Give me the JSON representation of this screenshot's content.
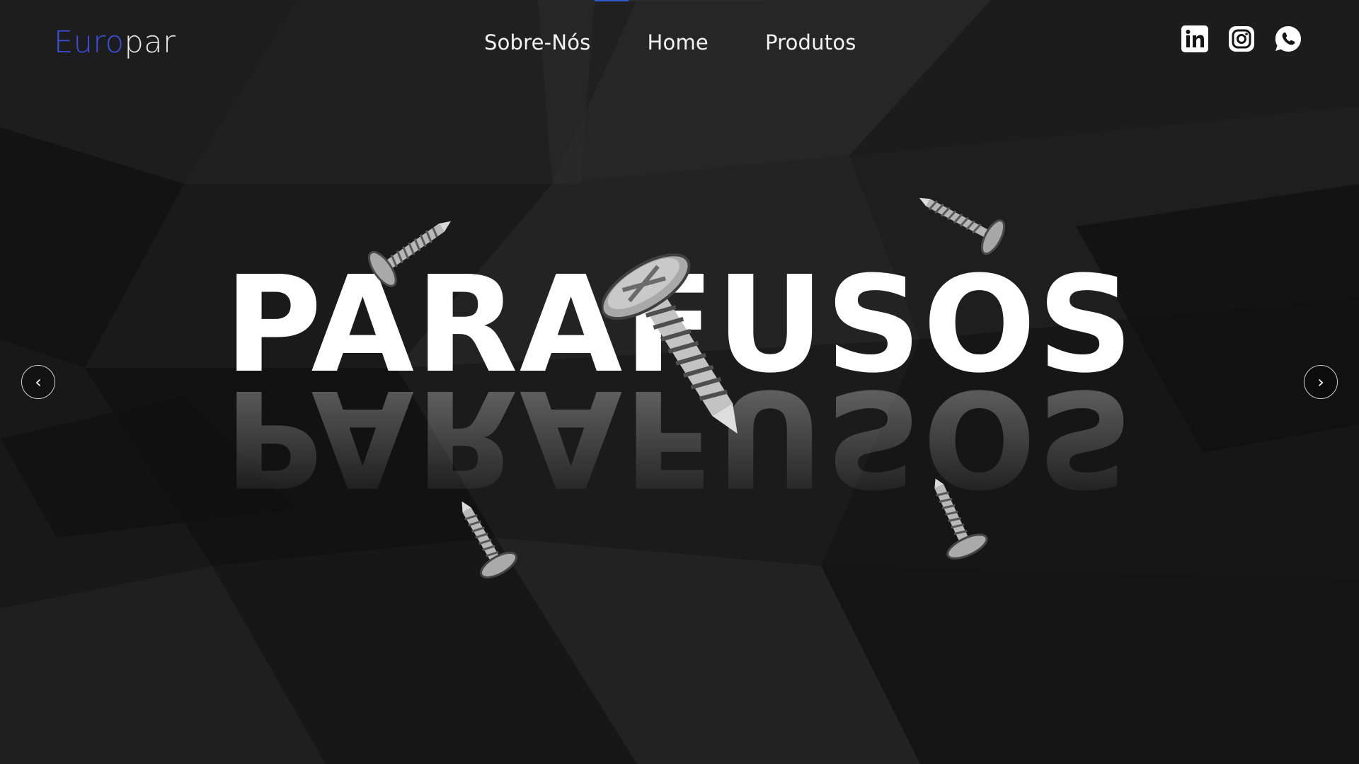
{
  "brand": {
    "logo_part1": "Euro",
    "logo_part2": "par"
  },
  "nav": {
    "items": [
      "Sobre-Nós",
      "Home",
      "Produtos"
    ],
    "active_index": 1
  },
  "socials": [
    {
      "icon": "linkedin-icon",
      "label": "in"
    },
    {
      "icon": "instagram-icon"
    },
    {
      "icon": "whatsapp-icon"
    }
  ],
  "hero": {
    "title": "PARAFUSOS"
  },
  "carousel": {
    "prev_glyph": "‹",
    "next_glyph": "›"
  },
  "colors": {
    "background": "#141414",
    "accent": "#3a4fe0",
    "text": "#ffffff"
  }
}
